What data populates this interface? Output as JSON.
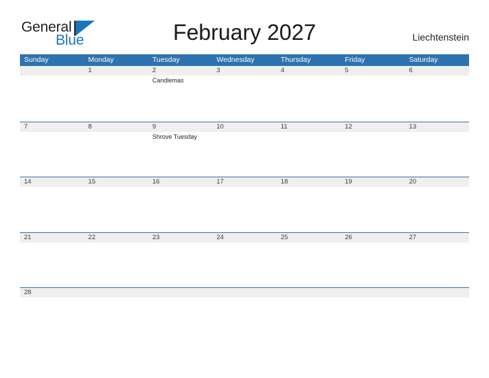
{
  "logo": {
    "word_top": "General",
    "word_bottom": "Blue",
    "flag_icon": "blue-triangle-flag-icon",
    "color_blue": "#1b75bb",
    "color_dark": "#231f20"
  },
  "header": {
    "title": "February 2027",
    "country": "Liechtenstein"
  },
  "calendar": {
    "accent_color": "#2e72b0",
    "band_color": "#efefef",
    "weekdays": [
      "Sunday",
      "Monday",
      "Tuesday",
      "Wednesday",
      "Thursday",
      "Friday",
      "Saturday"
    ],
    "weeks": [
      [
        {
          "date": "",
          "events": []
        },
        {
          "date": "1",
          "events": []
        },
        {
          "date": "2",
          "events": [
            "Candlemas"
          ]
        },
        {
          "date": "3",
          "events": []
        },
        {
          "date": "4",
          "events": []
        },
        {
          "date": "5",
          "events": []
        },
        {
          "date": "6",
          "events": []
        }
      ],
      [
        {
          "date": "7",
          "events": []
        },
        {
          "date": "8",
          "events": []
        },
        {
          "date": "9",
          "events": [
            "Shrove Tuesday"
          ]
        },
        {
          "date": "10",
          "events": []
        },
        {
          "date": "11",
          "events": []
        },
        {
          "date": "12",
          "events": []
        },
        {
          "date": "13",
          "events": []
        }
      ],
      [
        {
          "date": "14",
          "events": []
        },
        {
          "date": "15",
          "events": []
        },
        {
          "date": "16",
          "events": []
        },
        {
          "date": "17",
          "events": []
        },
        {
          "date": "18",
          "events": []
        },
        {
          "date": "19",
          "events": []
        },
        {
          "date": "20",
          "events": []
        }
      ],
      [
        {
          "date": "21",
          "events": []
        },
        {
          "date": "22",
          "events": []
        },
        {
          "date": "23",
          "events": []
        },
        {
          "date": "24",
          "events": []
        },
        {
          "date": "25",
          "events": []
        },
        {
          "date": "26",
          "events": []
        },
        {
          "date": "27",
          "events": []
        }
      ],
      [
        {
          "date": "28",
          "events": []
        },
        {
          "date": "",
          "events": []
        },
        {
          "date": "",
          "events": []
        },
        {
          "date": "",
          "events": []
        },
        {
          "date": "",
          "events": []
        },
        {
          "date": "",
          "events": []
        },
        {
          "date": "",
          "events": []
        }
      ]
    ]
  }
}
